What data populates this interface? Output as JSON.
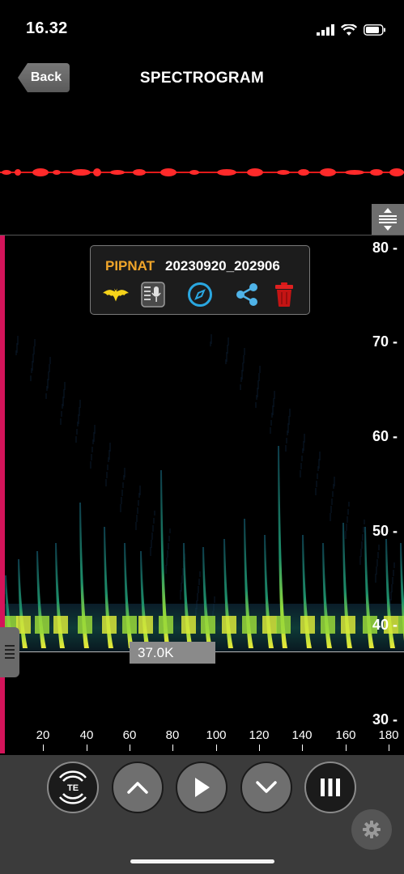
{
  "status_bar": {
    "time": "16.32"
  },
  "nav": {
    "back_label": "Back",
    "title": "SPECTROGRAM"
  },
  "info_popup": {
    "species": "PIPNAT",
    "filename": "20230920_202906",
    "icons": [
      "bat-icon",
      "voice-note-icon",
      "compass-icon",
      "share-icon",
      "trash-icon"
    ]
  },
  "spectrogram": {
    "frequency_marker": "37.0K",
    "y_ticks": [
      "80",
      "70",
      "60",
      "50",
      "40",
      "30"
    ],
    "x_ticks": [
      "20",
      "40",
      "60",
      "80",
      "100",
      "120",
      "140",
      "160",
      "180"
    ]
  },
  "controls": {
    "te_label": "TE",
    "buttons": [
      "te-button",
      "scroll-up-button",
      "play-button",
      "scroll-down-button",
      "menu-button"
    ]
  },
  "colors": {
    "accent": "#f0a52a",
    "left_bar": "#d4145a",
    "waveform": "#ff2020",
    "compass": "#2aa7e0",
    "share": "#4fb3e8",
    "trash": "#d81818"
  }
}
